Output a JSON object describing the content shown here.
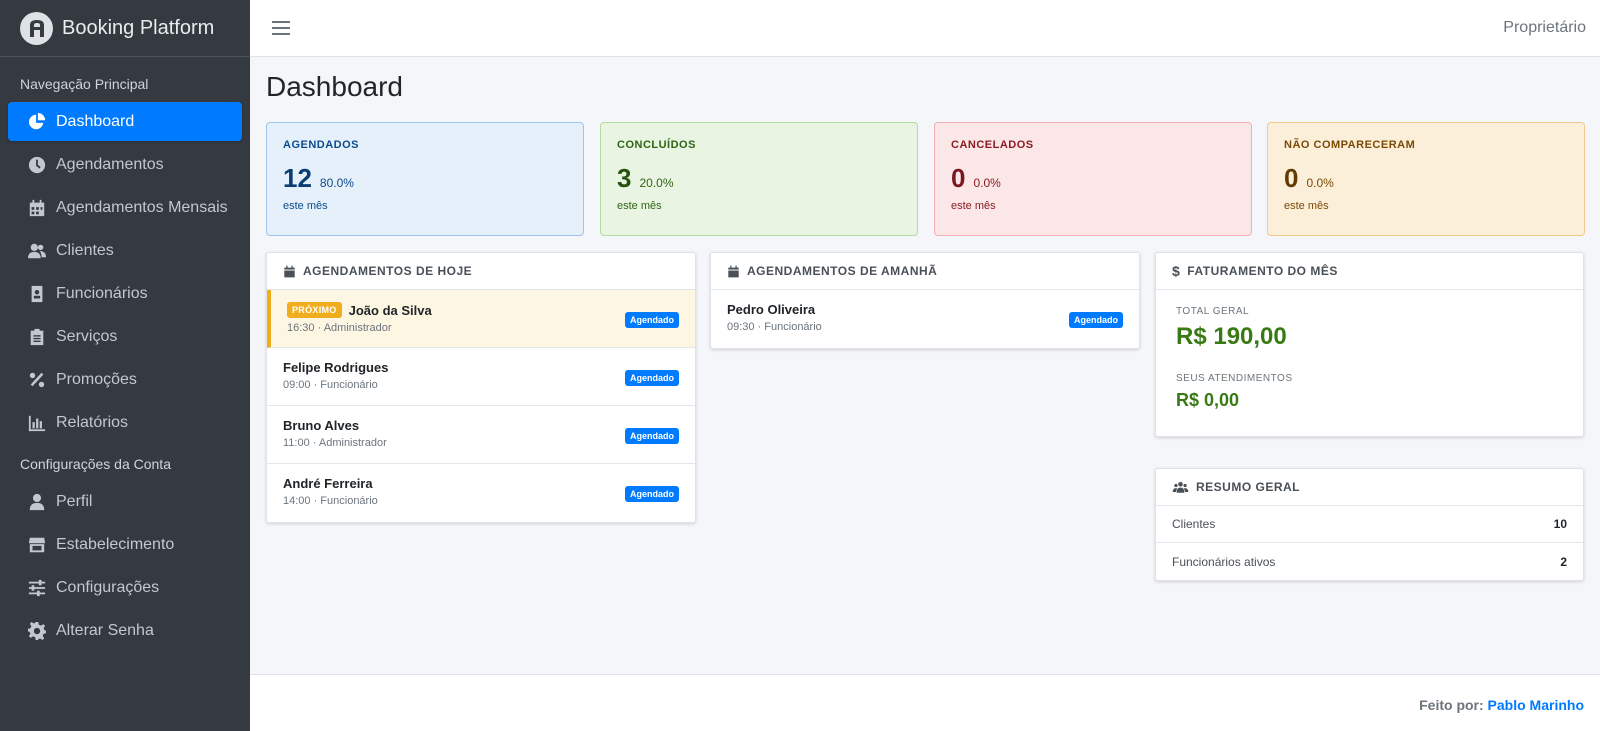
{
  "brand": {
    "title": "Booking Platform"
  },
  "sidebar": {
    "header_main": "Navegação Principal",
    "header_account": "Configurações da Conta",
    "items": [
      {
        "label": "Dashboard",
        "icon": "chart-pie-icon",
        "active": true
      },
      {
        "label": "Agendamentos",
        "icon": "clock-icon"
      },
      {
        "label": "Agendamentos Mensais",
        "icon": "calendar-icon"
      },
      {
        "label": "Clientes",
        "icon": "users-icon"
      },
      {
        "label": "Funcionários",
        "icon": "id-badge-icon"
      },
      {
        "label": "Serviços",
        "icon": "clipboard-icon"
      },
      {
        "label": "Promoções",
        "icon": "percent-icon"
      },
      {
        "label": "Relatórios",
        "icon": "bar-chart-icon"
      }
    ],
    "account_items": [
      {
        "label": "Perfil",
        "icon": "user-icon"
      },
      {
        "label": "Estabelecimento",
        "icon": "store-icon"
      },
      {
        "label": "Configurações",
        "icon": "sliders-icon"
      },
      {
        "label": "Alterar Senha",
        "icon": "gear-icon"
      }
    ]
  },
  "topbar": {
    "user": "Proprietário"
  },
  "page": {
    "title": "Dashboard"
  },
  "stats": [
    {
      "label": "AGENDADOS",
      "value": "12",
      "pct": "80.0%",
      "sub": "este mês",
      "color": "#0a3d73"
    },
    {
      "label": "CONCLUÍDOS",
      "value": "3",
      "pct": "20.0%",
      "sub": "este mês",
      "color": "#25530f"
    },
    {
      "label": "CANCELADOS",
      "value": "0",
      "pct": "0.0%",
      "sub": "este mês",
      "color": "#7a1720"
    },
    {
      "label": "NÃO COMPARECERAM",
      "value": "0",
      "pct": "0.0%",
      "sub": "este mês",
      "color": "#633a04"
    }
  ],
  "today": {
    "title": "AGENDAMENTOS DE HOJE",
    "next_label": "PRÓXIMO",
    "items": [
      {
        "name": "João da Silva",
        "meta": "16:30 · Administrador",
        "status": "Agendado"
      },
      {
        "name": "Felipe Rodrigues",
        "meta": "09:00 · Funcionário",
        "status": "Agendado"
      },
      {
        "name": "Bruno Alves",
        "meta": "11:00 · Administrador",
        "status": "Agendado"
      },
      {
        "name": "André Ferreira",
        "meta": "14:00 · Funcionário",
        "status": "Agendado"
      }
    ]
  },
  "tomorrow": {
    "title": "AGENDAMENTOS DE AMANHÃ",
    "items": [
      {
        "name": "Pedro Oliveira",
        "meta": "09:30 · Funcionário",
        "status": "Agendado"
      }
    ]
  },
  "revenue": {
    "title": "FATURAMENTO DO MÊS",
    "total_label": "TOTAL GERAL",
    "total_value": "R$ 190,00",
    "mine_label": "SEUS ATENDIMENTOS",
    "mine_value": "R$ 0,00"
  },
  "summary": {
    "title": "RESUMO GERAL",
    "rows": [
      {
        "label": "Clientes",
        "value": "10"
      },
      {
        "label": "Funcionários ativos",
        "value": "2"
      }
    ]
  },
  "footer": {
    "prefix": "Feito por:",
    "author": "Pablo Marinho"
  }
}
